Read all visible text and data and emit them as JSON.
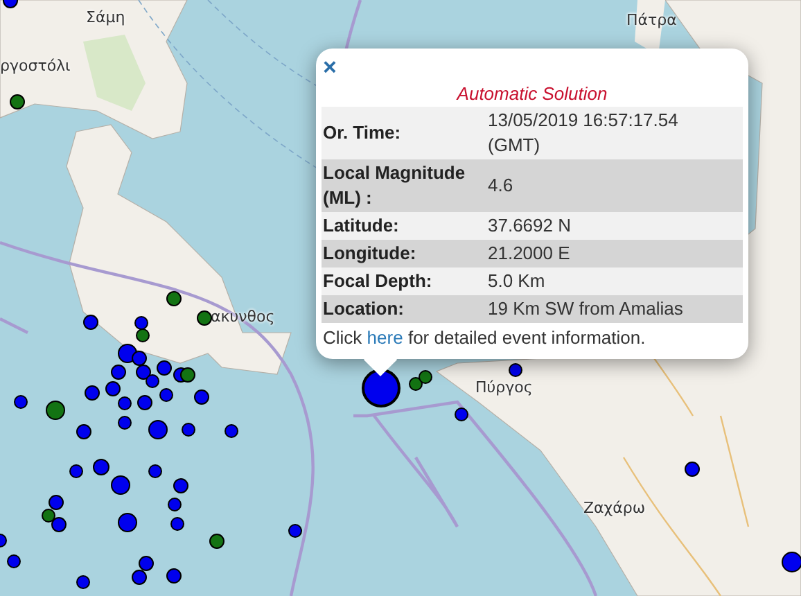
{
  "map": {
    "places": [
      {
        "name": "Σάμη"
      },
      {
        "name": "ργοστόλι"
      },
      {
        "name": "ακυνθος"
      },
      {
        "name": "Πύργος"
      },
      {
        "name": "Ζαχάρω"
      },
      {
        "name": "Πάτρα"
      }
    ],
    "markers": [
      {
        "color": "#0000ee"
      },
      {
        "color": "#137313"
      },
      {
        "color": "#137313"
      },
      {
        "color": "#137313"
      },
      {
        "color": "#0000ee"
      },
      {
        "color": "#0000ee"
      },
      {
        "color": "#0000ee"
      },
      {
        "color": "#0000ee"
      },
      {
        "color": "#0000ee"
      },
      {
        "color": "#0000ee"
      },
      {
        "color": "#0000ee"
      },
      {
        "color": "#0000ee"
      },
      {
        "color": "#0000ee"
      },
      {
        "color": "#0000ee"
      },
      {
        "color": "#0000ee"
      },
      {
        "color": "#0000ee"
      },
      {
        "color": "#0000ee"
      },
      {
        "color": "#137313"
      },
      {
        "color": "#137313"
      },
      {
        "color": "#0000ee"
      },
      {
        "color": "#0000ee"
      },
      {
        "color": "#137313"
      },
      {
        "color": "#0000ee"
      },
      {
        "color": "#0000ee"
      },
      {
        "color": "#0000ee"
      },
      {
        "color": "#0000ee"
      },
      {
        "color": "#0000ee"
      },
      {
        "color": "#0000ee"
      },
      {
        "color": "#0000ee"
      },
      {
        "color": "#0000ee"
      },
      {
        "color": "#0000ee"
      },
      {
        "color": "#0000ee"
      },
      {
        "color": "#0000ee"
      },
      {
        "color": "#0000ee"
      },
      {
        "color": "#137313"
      },
      {
        "color": "#0000ee"
      },
      {
        "color": "#0000ee"
      },
      {
        "color": "#0000ee"
      },
      {
        "color": "#0000ee"
      },
      {
        "color": "#137313"
      },
      {
        "color": "#0000ee"
      },
      {
        "color": "#0000ee"
      },
      {
        "color": "#0000ee"
      },
      {
        "color": "#0000ee"
      },
      {
        "color": "#0000ee"
      },
      {
        "color": "#0000ee"
      },
      {
        "color": "#0000ee"
      },
      {
        "color": "#0000ee"
      },
      {
        "color": "#137313"
      },
      {
        "color": "#137313"
      },
      {
        "color": "#0000ee"
      },
      {
        "color": "#0000ee"
      },
      {
        "color": "#0000ee"
      },
      {
        "color": "#0000ee"
      }
    ]
  },
  "popup": {
    "close": "×",
    "title": "Automatic Solution",
    "rows": [
      {
        "label": "Or. Time:",
        "value": "13/05/2019 16:57:17.54 (GMT)"
      },
      {
        "label": "Local Magnitude (ML) :",
        "value": "4.6"
      },
      {
        "label": "Latitude:",
        "value": "37.6692 N"
      },
      {
        "label": "Longitude:",
        "value": "21.2000 E"
      },
      {
        "label": "Focal Depth:",
        "value": "5.0 Km"
      },
      {
        "label": "Location:",
        "value": "19 Km SW from Amalias"
      }
    ],
    "footer": {
      "before": "Click",
      "link": "here",
      "after": "for detailed event information."
    }
  }
}
